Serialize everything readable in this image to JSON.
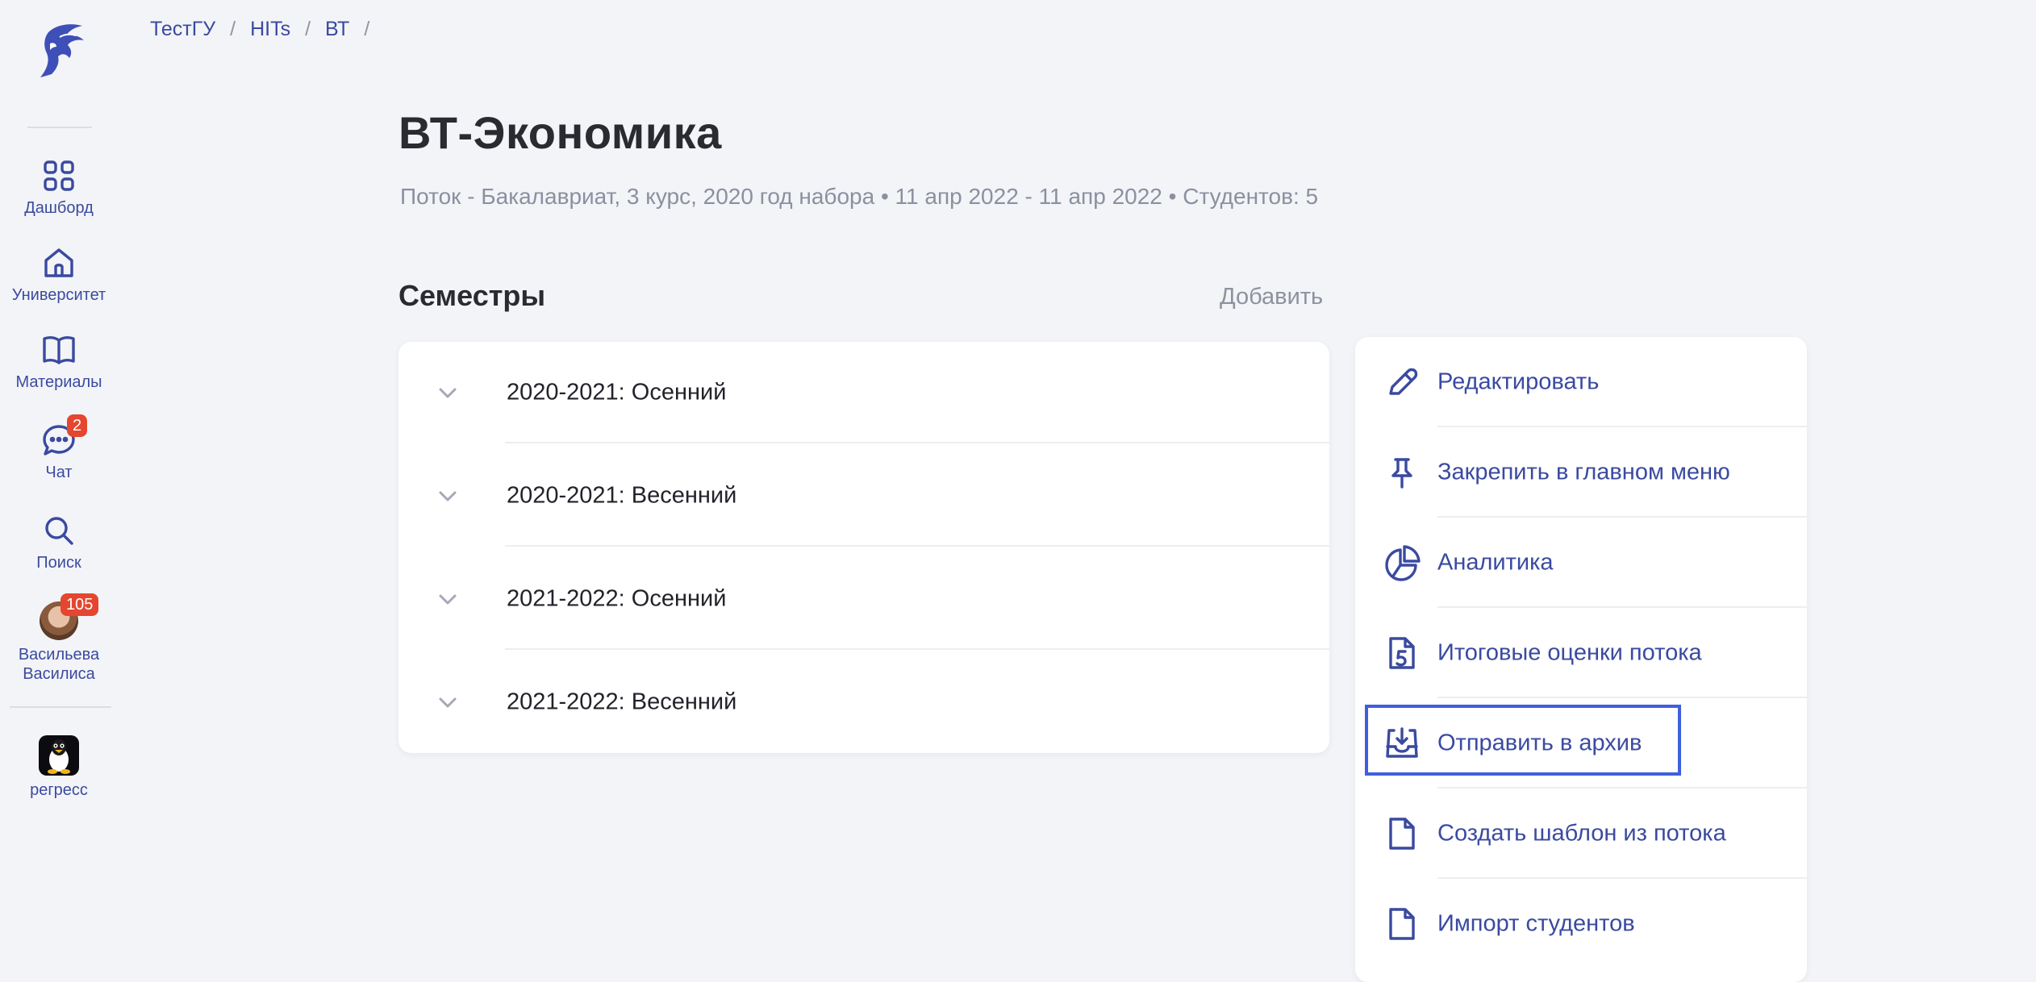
{
  "colors": {
    "background": "#f3f4f7",
    "accent": "#3a4aa0",
    "badge": "#e5462f",
    "highlight": "#3f5fe0",
    "muted": "#8b90a0"
  },
  "sidebar": {
    "items": [
      {
        "label": "Дашборд",
        "icon": "grid-icon"
      },
      {
        "label": "Университет",
        "icon": "home-icon"
      },
      {
        "label": "Материалы",
        "icon": "book-icon"
      },
      {
        "label": "Чат",
        "icon": "chat-icon",
        "badge": "2"
      },
      {
        "label": "Поиск",
        "icon": "search-icon"
      },
      {
        "label": "Васильева Василиса",
        "icon": "avatar",
        "badge": "105"
      }
    ],
    "workspace": {
      "label": "регресс",
      "icon": "linux-penguin-icon"
    }
  },
  "breadcrumb": {
    "items": [
      "ТестГУ",
      "HITs",
      "ВТ"
    ],
    "separator": "/"
  },
  "header": {
    "title": "ВТ-Экономика",
    "subtitle": "Поток - Бакалавриат, 3 курс, 2020 год набора • 11 апр 2022 - 11 апр 2022 • Студентов: 5"
  },
  "semesters": {
    "title": "Семестры",
    "add_label": "Добавить",
    "items": [
      "2020-2021: Осенний",
      "2020-2021: Весенний",
      "2021-2022: Осенний",
      "2021-2022: Весенний"
    ]
  },
  "actions": {
    "items": [
      {
        "label": "Редактировать",
        "icon": "pencil-icon"
      },
      {
        "label": "Закрепить в главном меню",
        "icon": "pin-icon"
      },
      {
        "label": "Аналитика",
        "icon": "pie-chart-icon"
      },
      {
        "label": "Итоговые оценки потока",
        "icon": "grade-file-icon"
      },
      {
        "label": "Отправить в архив",
        "icon": "archive-icon",
        "highlighted": true
      },
      {
        "label": "Создать шаблон из потока",
        "icon": "file-icon"
      },
      {
        "label": "Импорт студентов",
        "icon": "file-icon"
      }
    ]
  }
}
